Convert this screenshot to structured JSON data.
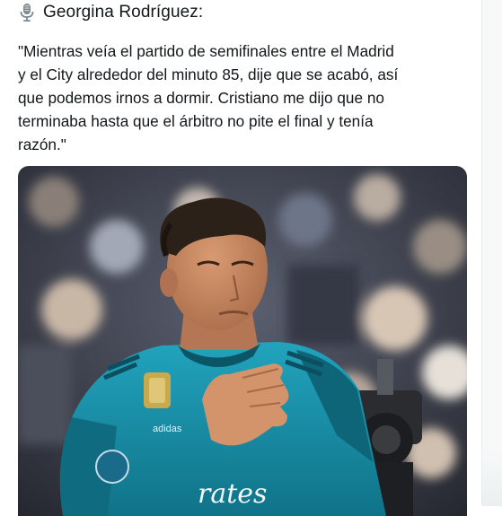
{
  "tweet": {
    "author": "Georgina Rodríguez:",
    "author_icon": "microphone-icon",
    "text": "\"Mientras veía el partido de semifinales entre el Madrid\ny el City alrededor del minuto 85, dije que se acabó, así\nque podemos irnos a dormir. Cristiano me dijo que no\nterminaba hasta que el árbitro no pite el final y tenía\nrazón.\""
  },
  "photo": {
    "jersey_text": "rates",
    "jersey_brand": "adidas",
    "colors": {
      "jersey": "#1a93ad",
      "jersey_dark": "#0d6a80",
      "skin": "#c98a64",
      "hair": "#2b2119",
      "crowd": "#3a3f4a"
    }
  }
}
